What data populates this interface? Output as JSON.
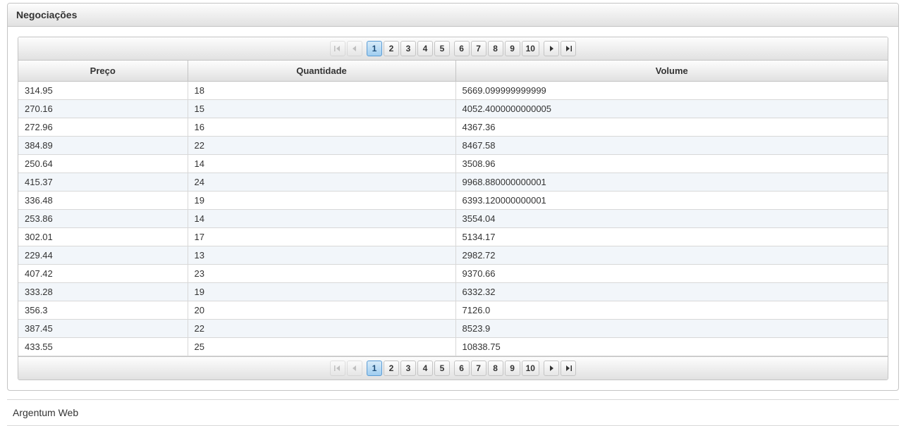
{
  "panel": {
    "title": "Negociações"
  },
  "columns": {
    "preco": "Preço",
    "quantidade": "Quantidade",
    "volume": "Volume"
  },
  "paginator": {
    "pages": [
      "1",
      "2",
      "3",
      "4",
      "5",
      "6",
      "7",
      "8",
      "9",
      "10"
    ],
    "current": "1"
  },
  "rows": [
    {
      "preco": "314.95",
      "quantidade": "18",
      "volume": "5669.099999999999"
    },
    {
      "preco": "270.16",
      "quantidade": "15",
      "volume": "4052.4000000000005"
    },
    {
      "preco": "272.96",
      "quantidade": "16",
      "volume": "4367.36"
    },
    {
      "preco": "384.89",
      "quantidade": "22",
      "volume": "8467.58"
    },
    {
      "preco": "250.64",
      "quantidade": "14",
      "volume": "3508.96"
    },
    {
      "preco": "415.37",
      "quantidade": "24",
      "volume": "9968.880000000001"
    },
    {
      "preco": "336.48",
      "quantidade": "19",
      "volume": "6393.120000000001"
    },
    {
      "preco": "253.86",
      "quantidade": "14",
      "volume": "3554.04"
    },
    {
      "preco": "302.01",
      "quantidade": "17",
      "volume": "5134.17"
    },
    {
      "preco": "229.44",
      "quantidade": "13",
      "volume": "2982.72"
    },
    {
      "preco": "407.42",
      "quantidade": "23",
      "volume": "9370.66"
    },
    {
      "preco": "333.28",
      "quantidade": "19",
      "volume": "6332.32"
    },
    {
      "preco": "356.3",
      "quantidade": "20",
      "volume": "7126.0"
    },
    {
      "preco": "387.45",
      "quantidade": "22",
      "volume": "8523.9"
    },
    {
      "preco": "433.55",
      "quantidade": "25",
      "volume": "10838.75"
    }
  ],
  "footer": {
    "text": "Argentum Web"
  }
}
